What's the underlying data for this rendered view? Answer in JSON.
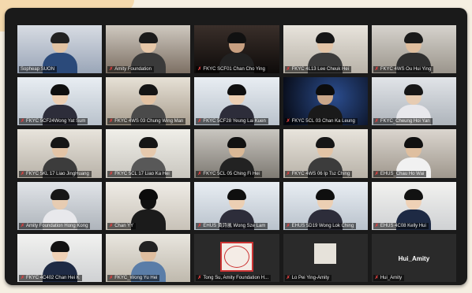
{
  "participants": [
    {
      "name": "Sopheap SUON",
      "mic": false,
      "type": "crowd",
      "active": true
    },
    {
      "name": "Amity Foundation",
      "mic": true,
      "type": "two"
    },
    {
      "name": "FKYC SCF01 Chan Cho Ying",
      "mic": true,
      "type": "dark"
    },
    {
      "name": "FKYC 4L13 Lee Cheuk Hei",
      "mic": true,
      "type": "room"
    },
    {
      "name": "FKYC 4WS Ou Hui Ying",
      "mic": true,
      "type": "room2"
    },
    {
      "name": "FKYC 5CF24Wong Yat Sum",
      "mic": true,
      "type": "girl"
    },
    {
      "name": "FKYC 4WS 03 Chung Wing Man",
      "mic": true,
      "type": "shelf"
    },
    {
      "name": "FKYC 5CF28 Yeung Lai Kuen",
      "mic": true,
      "type": "girl"
    },
    {
      "name": "FKYC 5CL 03 Chan Ka Leung",
      "mic": true,
      "type": "space"
    },
    {
      "name": "FKYC_Cheung Hoi Yan",
      "mic": true,
      "type": "mask"
    },
    {
      "name": "FKYC 5KL 17 Liao JingHuang",
      "mic": true,
      "type": "room"
    },
    {
      "name": "FKYC 5CL 17 Liao Ka Hei",
      "mic": true,
      "type": "room3"
    },
    {
      "name": "FKYC 5CL 05 Ching Fi Hei",
      "mic": true,
      "type": "boy"
    },
    {
      "name": "FKYC 4WS 06 Ip Tsz Ching",
      "mic": true,
      "type": "room"
    },
    {
      "name": "EHUS_Chau Ho Wai",
      "mic": true,
      "type": "boy2"
    },
    {
      "name": "Amity Foundation Hong Kong",
      "mic": true,
      "type": "mask"
    },
    {
      "name": "Chan YY",
      "mic": true,
      "type": "back"
    },
    {
      "name": "EHUS 黃詩嵐 Wong Sze Lam",
      "mic": true,
      "type": "girl"
    },
    {
      "name": "EHUS 5D19 Wong Lok Ching",
      "mic": true,
      "type": "girl"
    },
    {
      "name": "EHUS 4C08 Kelly Hui",
      "mic": true,
      "type": "girl2"
    },
    {
      "name": "FKYC 4C402 Chan Hei K",
      "mic": true,
      "type": "girl2"
    },
    {
      "name": "FKYC_Wong Yu Hei",
      "mic": true,
      "type": "photo"
    },
    {
      "name": "Tong Su, Amity Foundation H...",
      "mic": true,
      "type": "seal"
    },
    {
      "name": "Lo Pei Ying-Amity",
      "mic": true,
      "type": "small"
    },
    {
      "name": "Hui_Amity",
      "mic": true,
      "type": "text",
      "display": "Hui_Amity"
    }
  ],
  "colors": {
    "frame": "#1a1a1a",
    "active_outline": "#d6c44b",
    "mic_muted": "#e04040",
    "tile_bg": "#2b2b2b"
  },
  "icons": {
    "mic": "mic-muted-icon"
  }
}
